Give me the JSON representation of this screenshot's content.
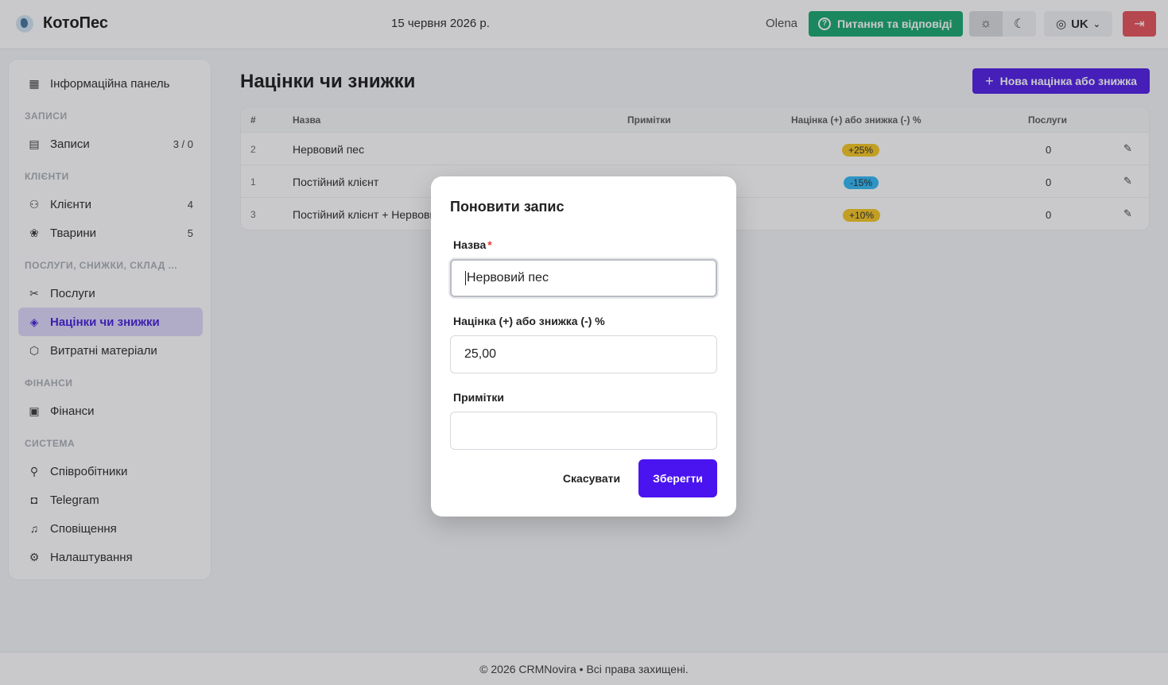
{
  "header": {
    "app_name": "КотоПес",
    "date": "15 червня 2026 р.",
    "user": "Olena",
    "help_label": "Питання та відповіді",
    "lang_label": "UK"
  },
  "sidebar": {
    "dashboard": "Інформаційна панель",
    "sections": [
      "ЗАПИСИ",
      "КЛІЄНТИ",
      "ПОСЛУГИ, СНИЖКИ, СКЛАД ...",
      "ФІНАНСИ",
      "СИСТЕМА"
    ],
    "items": [
      {
        "label": "Записи",
        "count": "3 / 0"
      },
      {
        "label": "Клієнти",
        "count": "4"
      },
      {
        "label": "Тварини",
        "count": "5"
      },
      {
        "label": "Послуги"
      },
      {
        "label": "Націнки чи знижки"
      },
      {
        "label": "Витратні матеріали"
      },
      {
        "label": "Фінанси"
      },
      {
        "label": "Співробітники"
      },
      {
        "label": "Telegram"
      },
      {
        "label": "Сповіщення"
      },
      {
        "label": "Налаштування"
      }
    ]
  },
  "page": {
    "title": "Націнки чи знижки",
    "new_button": "Нова націнка або знижка"
  },
  "table": {
    "columns": [
      "#",
      "Назва",
      "Примітки",
      "Націнка (+) або знижка (-) %",
      "Послуги"
    ],
    "rows": [
      {
        "id": "2",
        "name": "Нервовий пес",
        "notes": "",
        "percent": "+25%",
        "services": "0",
        "badge_color": "#f5c518"
      },
      {
        "id": "1",
        "name": "Постійний клієнт",
        "notes": "",
        "percent": "-15%",
        "services": "0",
        "badge_color": "#29b6f6"
      },
      {
        "id": "3",
        "name": "Постійний клієнт + Нервовий пес",
        "notes": "",
        "percent": "+10%",
        "services": "0",
        "badge_color": "#f5c518"
      }
    ]
  },
  "modal": {
    "title": "Поновити запис",
    "name_label": "Назва",
    "name_required": "*",
    "name_value": "Нервовий пес",
    "percent_label": "Націнка (+) або знижка (-) %",
    "percent_value": "25,00",
    "notes_label": "Примітки",
    "notes_value": "",
    "cancel_label": "Скасувати",
    "save_label": "Зберегти"
  },
  "footer": {
    "text": "© 2026 CRMNovira • Всі права захищені."
  },
  "colors": {
    "primary": "#4a14f0",
    "help_green": "#0fa46a",
    "logout_red": "#e64b52",
    "badge_yellow": "#f5c518",
    "badge_blue": "#29b6f6"
  }
}
